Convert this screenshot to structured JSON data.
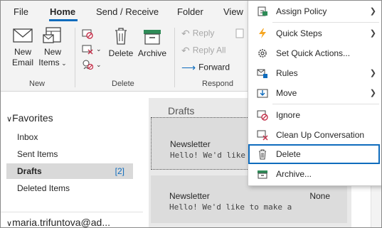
{
  "ribbon": {
    "tabs": [
      "File",
      "Home",
      "Send / Receive",
      "Folder",
      "View"
    ],
    "active_tab": "Home",
    "groups": {
      "new": {
        "label": "New",
        "new_email": [
          "New",
          "Email"
        ],
        "new_items": [
          "New",
          "Items"
        ]
      },
      "delete": {
        "label": "Delete",
        "delete": "Delete",
        "archive": "Archive"
      },
      "respond": {
        "label": "Respond",
        "reply": "Reply",
        "reply_all": "Reply All",
        "forward": "Forward"
      }
    }
  },
  "nav": {
    "favorites_label": "Favorites",
    "folders": [
      {
        "name": "Inbox",
        "count": ""
      },
      {
        "name": "Sent Items",
        "count": ""
      },
      {
        "name": "Drafts",
        "count": "[2]"
      },
      {
        "name": "Deleted Items",
        "count": ""
      }
    ],
    "selected_folder": "Drafts",
    "account": "maria.trifuntova@ad..."
  },
  "message_list": {
    "header": "Drafts",
    "messages": [
      {
        "from": "Newsletter",
        "preview": "Hello! We'd like to make a",
        "extra": ""
      },
      {
        "from": "Newsletter",
        "preview": "Hello! We'd like to make a",
        "extra": "None"
      }
    ]
  },
  "context_menu": {
    "items": [
      {
        "label": "Assign Policy",
        "icon": "assign-policy-icon",
        "submenu": true
      },
      {
        "label": "Quick Steps",
        "icon": "lightning-icon",
        "submenu": true
      },
      {
        "label": "Set Quick Actions...",
        "icon": "gear-icon",
        "submenu": false
      },
      {
        "label": "Rules",
        "icon": "rules-icon",
        "submenu": true
      },
      {
        "label": "Move",
        "icon": "move-icon",
        "submenu": true
      },
      {
        "label": "Ignore",
        "icon": "ignore-icon",
        "submenu": false
      },
      {
        "label": "Clean Up Conversation",
        "icon": "cleanup-icon",
        "submenu": false
      },
      {
        "label": "Delete",
        "icon": "trash-icon",
        "submenu": false
      },
      {
        "label": "Archive...",
        "icon": "archive-icon",
        "submenu": false
      }
    ],
    "highlighted": "Delete"
  },
  "colors": {
    "accent": "#0f6cbd",
    "ribbon_bg": "#f3f3f3",
    "selection_bg": "#d9d9d9",
    "quick_steps_icon": "#f5a623",
    "archive_icon": "#2e8b57",
    "red_icon": "#c4314b"
  }
}
